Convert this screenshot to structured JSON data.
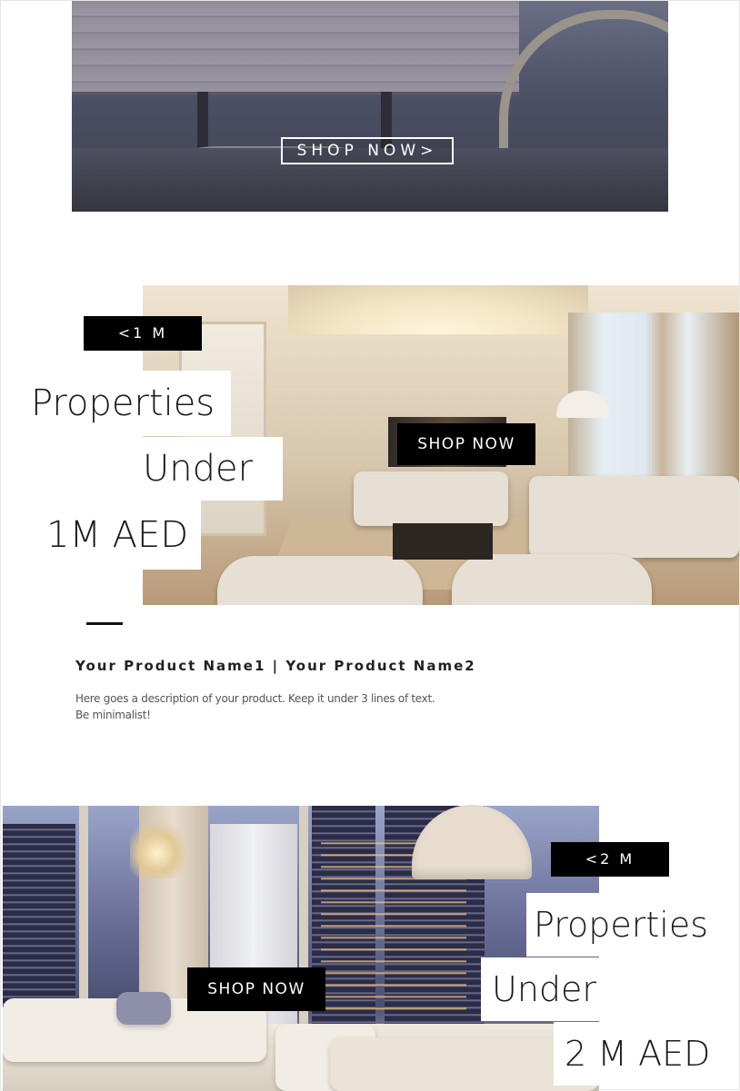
{
  "banner_top": {
    "shop_label": "SHOP NOW>"
  },
  "promo_1m": {
    "badge": "<1 M",
    "title_line1": "Properties",
    "title_line2": "Under",
    "title_line3": "1M AED",
    "shop_label": "SHOP NOW"
  },
  "product": {
    "name": "Your Product Name1 | Your Product Name2",
    "description_line1": "Here goes a description of your product.  Keep it under 3 lines of text.",
    "description_line2": "Be minimalist!"
  },
  "promo_2m": {
    "badge": "<2 M",
    "title_line1": "Properties",
    "title_line2": "Under",
    "title_line3": "2 M AED",
    "shop_label": "SHOP NOW"
  },
  "colors": {
    "badge_bg": "#000000",
    "badge_text": "#ffffff",
    "title_text": "#1a1a1a",
    "page_bg": "#ffffff"
  }
}
